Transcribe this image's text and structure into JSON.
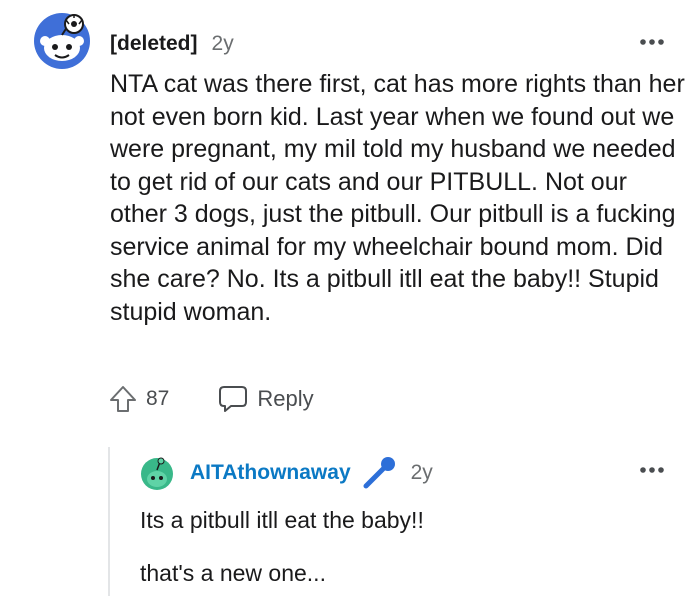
{
  "comment": {
    "author": "[deleted]",
    "age": "2y",
    "body": "NTA cat was there first, cat has more rights than her not even born kid. Last year when we found out we were pregnant, my mil told my husband we needed to get rid of our cats and our PITBULL. Not our other 3 dogs, just the pitbull. Our pitbull is a fucking service animal for my wheelchair bound mom. Did she care? No. Its a pitbull itll eat the baby!! Stupid stupid woman.",
    "upvotes": "87",
    "reply_label": "Reply"
  },
  "reply": {
    "author": "AITAthownaway",
    "age": "2y",
    "paragraphs": [
      "Its a pitbull itll eat the baby!!",
      "that's a new one..."
    ]
  },
  "colors": {
    "author_link": "#0b79c4",
    "avatar_blue": "#3f6fd8",
    "avatar_green": "#39b889",
    "mic_blue": "#2d6fd8"
  },
  "icons": {
    "top_avatar": "snoo-avatar-icon",
    "reply_avatar": "snoo-avatar-icon",
    "upvote": "upvote-arrow-icon",
    "reply": "speech-bubble-icon",
    "more": "ellipsis-icon",
    "mic": "microphone-icon"
  }
}
